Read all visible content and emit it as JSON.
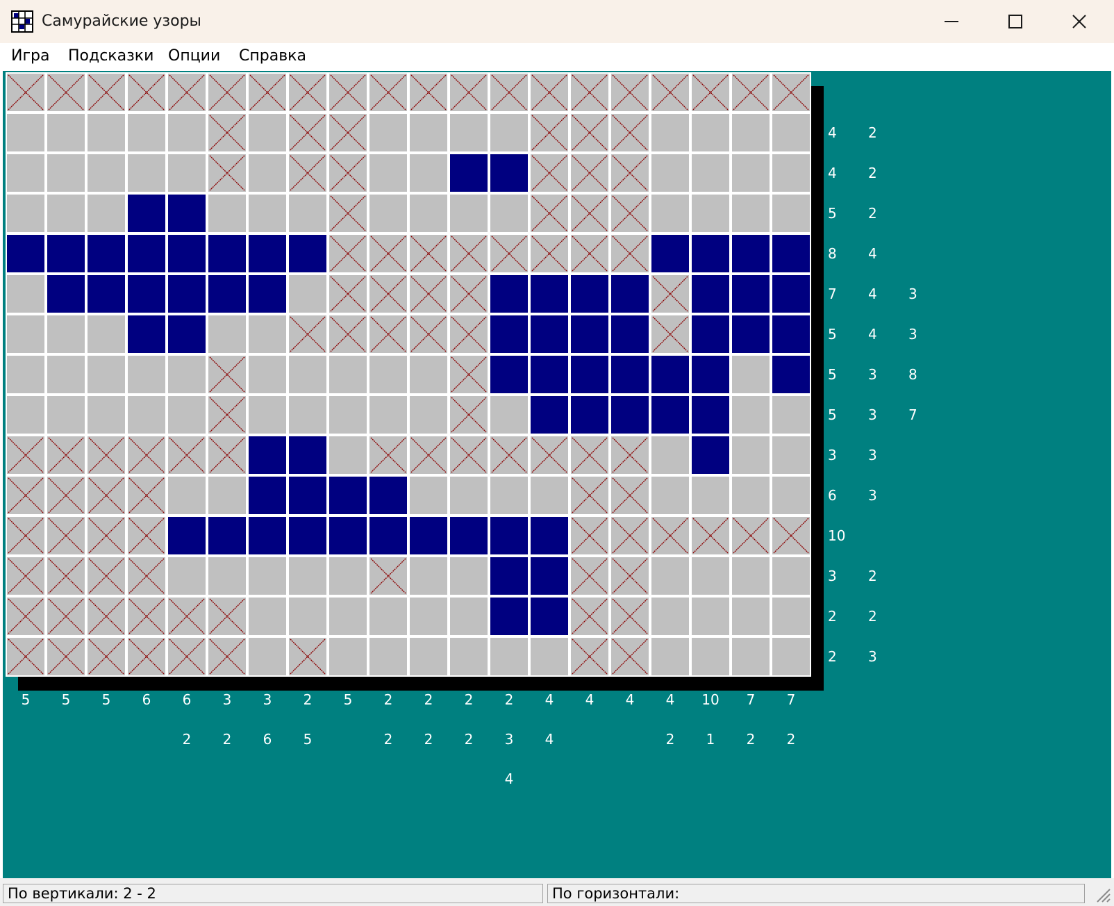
{
  "window": {
    "title": "Самурайские узоры",
    "icon": "grid-app-icon",
    "controls": [
      "minimize-icon",
      "maximize-icon",
      "close-icon"
    ]
  },
  "menu": [
    "Игра",
    "Подсказки",
    "Опции",
    "Справка"
  ],
  "colors": {
    "background": "#008080",
    "cell_empty": "#c0c0c0",
    "cell_filled": "#000080",
    "cross_mark": "#8b0000",
    "clue_text": "#ffffff"
  },
  "puzzle": {
    "rows": [
      "XXXXXXXXXXXXXXXXXXXX",
      ".....X.XX....XXX....",
      ".....X.XX..##XXX....",
      "...##...X....XXX....",
      "########XXXXXXXX####",
      ".######.XXXX####X###",
      "...##..XXXXX####X###",
      ".....X.....X######.#",
      ".....X.....X.#####..",
      "XXXXXX##.XXXXXXX.#..",
      "XXXX..####....XX....",
      "XXXX##########XXXXXX",
      "XXXX.....X..##XX....",
      "XXXXXX......##XX....",
      "XXXXXX.X......XX...."
    ],
    "row_clues": [
      [],
      [
        "4",
        "2"
      ],
      [
        "4",
        "2"
      ],
      [
        "5",
        "2"
      ],
      [
        "8",
        "4"
      ],
      [
        "7",
        "4",
        "3"
      ],
      [
        "5",
        "4",
        "3"
      ],
      [
        "5",
        "3",
        "8"
      ],
      [
        "5",
        "3",
        "7"
      ],
      [
        "3",
        "3"
      ],
      [
        "6",
        "3"
      ],
      [
        "10"
      ],
      [
        "3",
        "2"
      ],
      [
        "2",
        "2"
      ],
      [
        "2",
        "3"
      ]
    ],
    "col_clues": [
      [
        "5"
      ],
      [
        "5"
      ],
      [
        "5"
      ],
      [
        "6"
      ],
      [
        "6",
        "2"
      ],
      [
        "3",
        "2"
      ],
      [
        "3",
        "6"
      ],
      [
        "2",
        "5"
      ],
      [
        "5"
      ],
      [
        "2",
        "2"
      ],
      [
        "2",
        "2"
      ],
      [
        "2",
        "2"
      ],
      [
        "2",
        "3",
        "4"
      ],
      [
        "4",
        "4"
      ],
      [
        "4"
      ],
      [
        "4"
      ],
      [
        "4",
        "2"
      ],
      [
        "10",
        "1"
      ],
      [
        "7",
        "2"
      ],
      [
        "7",
        "2"
      ]
    ]
  },
  "status": {
    "vertical": "По вертикали:  2 - 2",
    "horizontal": "По горизонтали:"
  }
}
